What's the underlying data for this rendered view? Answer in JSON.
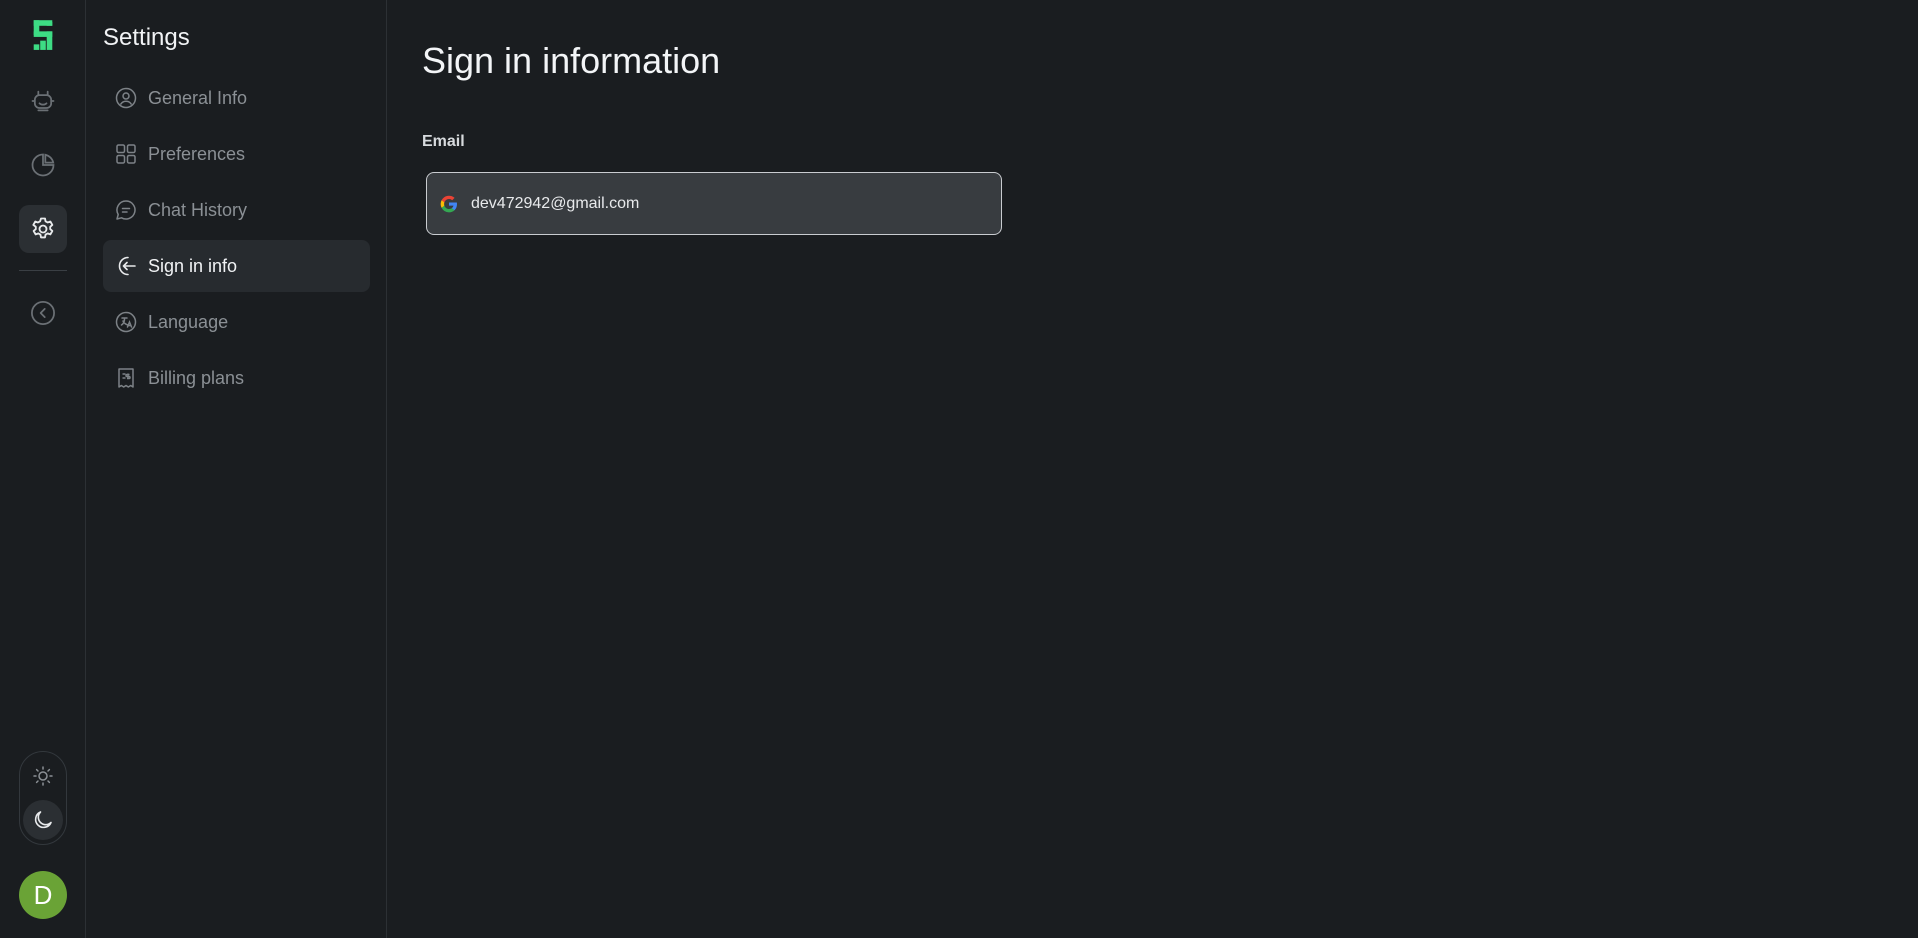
{
  "rail": {
    "logo_icon": "brand-s-logo",
    "items": [
      {
        "icon": "robot-icon",
        "active": false
      },
      {
        "icon": "pie-chart-icon",
        "active": false
      },
      {
        "icon": "gear-icon",
        "active": true
      }
    ],
    "collapse_icon": "chevron-left-circle-icon",
    "theme": {
      "light_icon": "sun-icon",
      "dark_icon": "moon-icon",
      "selected": "dark"
    },
    "avatar_initial": "D",
    "avatar_color": "#6aa336"
  },
  "settings": {
    "title": "Settings",
    "items": [
      {
        "label": "General Info",
        "icon": "user-circle-icon"
      },
      {
        "label": "Preferences",
        "icon": "grid-icon"
      },
      {
        "label": "Chat History",
        "icon": "chat-bubble-icon"
      },
      {
        "label": "Sign in info",
        "icon": "sign-in-icon"
      },
      {
        "label": "Language",
        "icon": "translate-icon"
      },
      {
        "label": "Billing plans",
        "icon": "receipt-icon"
      }
    ],
    "active_index": 3
  },
  "main": {
    "title": "Sign in information",
    "email_label": "Email",
    "email_value": "dev472942@gmail.com",
    "provider_icon": "google-icon"
  },
  "colors": {
    "background": "#1a1d20",
    "brand_green": "#3ddc84",
    "active_bg": "#272b2f"
  }
}
